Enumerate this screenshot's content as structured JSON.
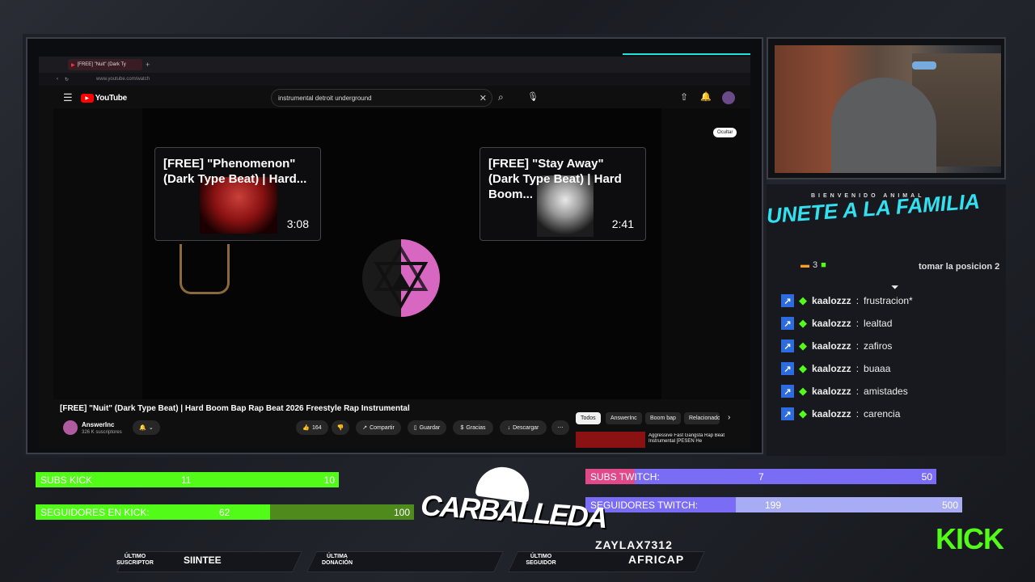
{
  "browser": {
    "tab_title": "[FREE] \"Nuit\" (Dark Ty",
    "url": "www.youtube.com/watch"
  },
  "youtube": {
    "logo": "YouTube",
    "search_value": "instrumental detroit underground",
    "hide_label": "Ocultar",
    "end_cards": [
      {
        "title": "[FREE] \"Phenomenon\" (Dark Type Beat) | Hard...",
        "duration": "3:08"
      },
      {
        "title": "[FREE] \"Stay Away\" (Dark Type Beat) | Hard Boom...",
        "duration": "2:41"
      }
    ],
    "video_title": "[FREE] \"Nuit\" (Dark Type Beat) | Hard Boom Bap Rap Beat 2026 Freestyle Rap Instrumental",
    "channel_name": "AnswerInc",
    "subscribers": "326 K suscriptores",
    "likes": "164",
    "actions": {
      "share": "Compartir",
      "save": "Guardar",
      "thanks": "Gracias",
      "download": "Descargar"
    },
    "chips": [
      "Todos",
      "AnswerInc",
      "Boom bap",
      "Relacionado"
    ],
    "rec_title": "Aggressive Fast Gangsta Rap Beat Instrumental [PESEN He"
  },
  "overlay": {
    "welcome_small": "BIENVENIDO ANIMAL",
    "join_text": "UNETE A LA FAMILIA",
    "top_partial": "3",
    "position_text": "tomar la posicion 2",
    "chat": [
      {
        "user": "kaalozzz",
        "msg": "frustracion*"
      },
      {
        "user": "kaalozzz",
        "msg": "lealtad"
      },
      {
        "user": "kaalozzz",
        "msg": "zafiros"
      },
      {
        "user": "kaalozzz",
        "msg": "buaaa"
      },
      {
        "user": "kaalozzz",
        "msg": "amistades"
      },
      {
        "user": "kaalozzz",
        "msg": "carencia"
      }
    ],
    "goals": {
      "subs_kick": {
        "label": "SUBS KICK",
        "current": "11",
        "max": "10",
        "fraction": 1.0
      },
      "seg_kick": {
        "label": "SEGUIDORES EN KICK:",
        "current": "62",
        "max": "100",
        "fraction": 0.62
      },
      "subs_twitch": {
        "label": "SUBS TWITCH:",
        "current": "7",
        "max": "50",
        "fraction": 0.14
      },
      "seg_twitch": {
        "label": "SEGUIDORES TWITCH:",
        "current": "199",
        "max": "500",
        "fraction": 0.4
      }
    },
    "logo_text": "CARBALLEDA",
    "kick_logo": "KICK",
    "last_sub_label": "ÚLTIMO SUSCRIPTOR",
    "last_sub_value": "SIINTEE",
    "last_donation_label": "ÚLTIMA DONACIÓN",
    "last_donation_value": "",
    "last_follower_label": "ÚLTIMO SEGUIDOR",
    "last_follower_value_1": "ZAYLAX7312",
    "last_follower_value_2": "AFRICAP"
  },
  "colors": {
    "kick_green": "#53fc18",
    "twitch_purple": "#7b6cf6",
    "accent_cyan": "#1ee3d8",
    "yt_red": "#ff0000"
  }
}
